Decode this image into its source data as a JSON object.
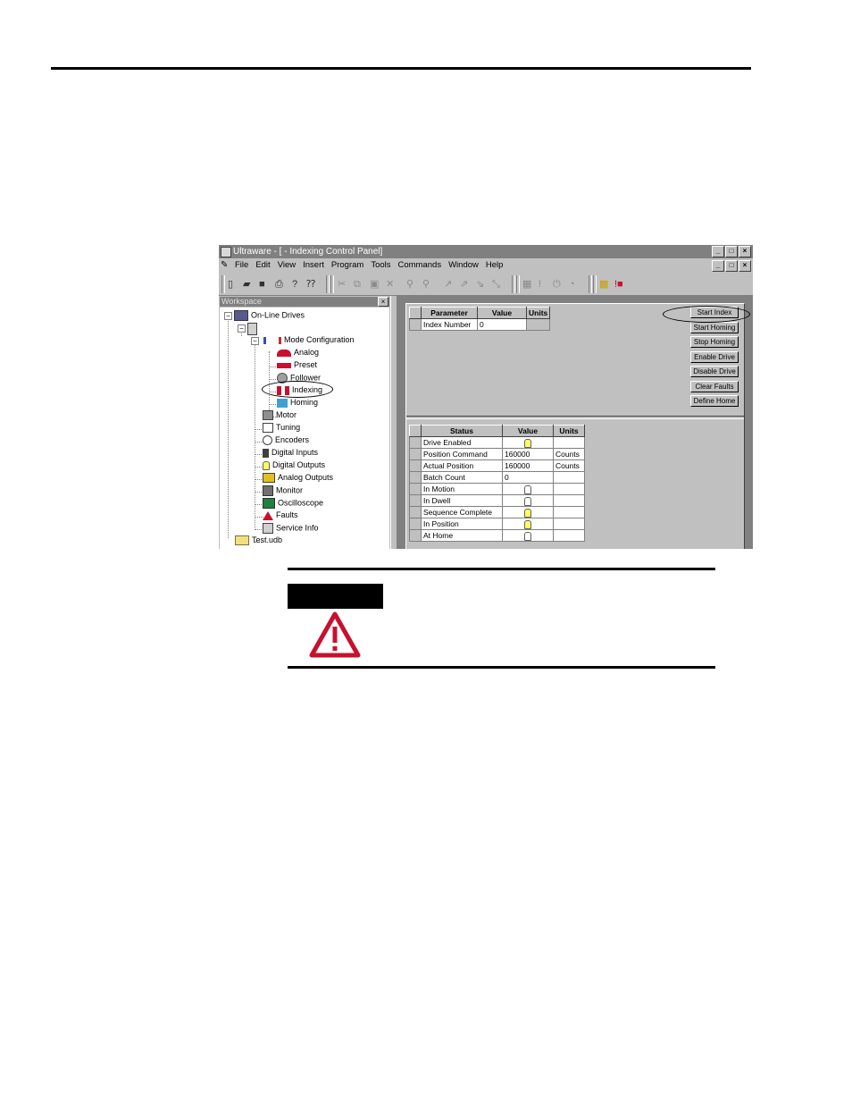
{
  "window": {
    "title": "Ultraware - [ - Indexing Control Panel]",
    "controls": [
      "_",
      "□",
      "×"
    ]
  },
  "menubar": {
    "items": [
      "File",
      "Edit",
      "View",
      "Insert",
      "Program",
      "Tools",
      "Commands",
      "Window",
      "Help"
    ]
  },
  "workspace": {
    "title": "Workspace",
    "close": "×",
    "tree": {
      "online_drives": "On-Line Drives",
      "drive_node": "",
      "mode_configuration": "Mode Configuration",
      "analog": "Analog",
      "preset": "Preset",
      "follower": "Follower",
      "indexing": "Indexing",
      "homing": "Homing",
      "motor": "Motor",
      "tuning": "Tuning",
      "encoders": "Encoders",
      "digital_inputs": "Digital Inputs",
      "digital_outputs": "Digital Outputs",
      "analog_outputs": "Analog Outputs",
      "monitor": "Monitor",
      "oscilloscope": "Oscilloscope",
      "faults": "Faults",
      "service_info": "Service Info",
      "test_udb": "Test.udb"
    }
  },
  "parameters": {
    "headers": [
      "Parameter",
      "Value",
      "Units"
    ],
    "rows": [
      {
        "name": "Index Number",
        "value": "0",
        "units": ""
      }
    ]
  },
  "commands": {
    "start_index": "Start Index",
    "start_homing": "Start Homing",
    "stop_homing": "Stop Homing",
    "enable_drive": "Enable Drive",
    "disable_drive": "Disable Drive",
    "clear_faults": "Clear Faults",
    "define_home": "Define Home"
  },
  "status": {
    "headers": [
      "Status",
      "Value",
      "Units"
    ],
    "rows": [
      {
        "name": "Drive Enabled",
        "value": "",
        "units": "",
        "indicator": "on"
      },
      {
        "name": "Position Command",
        "value": "160000",
        "units": "Counts"
      },
      {
        "name": "Actual Position",
        "value": "160000",
        "units": "Counts"
      },
      {
        "name": "Batch Count",
        "value": "0",
        "units": ""
      },
      {
        "name": "In Motion",
        "value": "",
        "units": "",
        "indicator": "off"
      },
      {
        "name": "In Dwell",
        "value": "",
        "units": "",
        "indicator": "off"
      },
      {
        "name": "Sequence Complete",
        "value": "",
        "units": "",
        "indicator": "on"
      },
      {
        "name": "In Position",
        "value": "",
        "units": "",
        "indicator": "on"
      },
      {
        "name": "At Home",
        "value": "",
        "units": "",
        "indicator": "off"
      }
    ]
  },
  "colors": {
    "warning_red": "#c8102e",
    "indicator_on": "#ffff60"
  }
}
